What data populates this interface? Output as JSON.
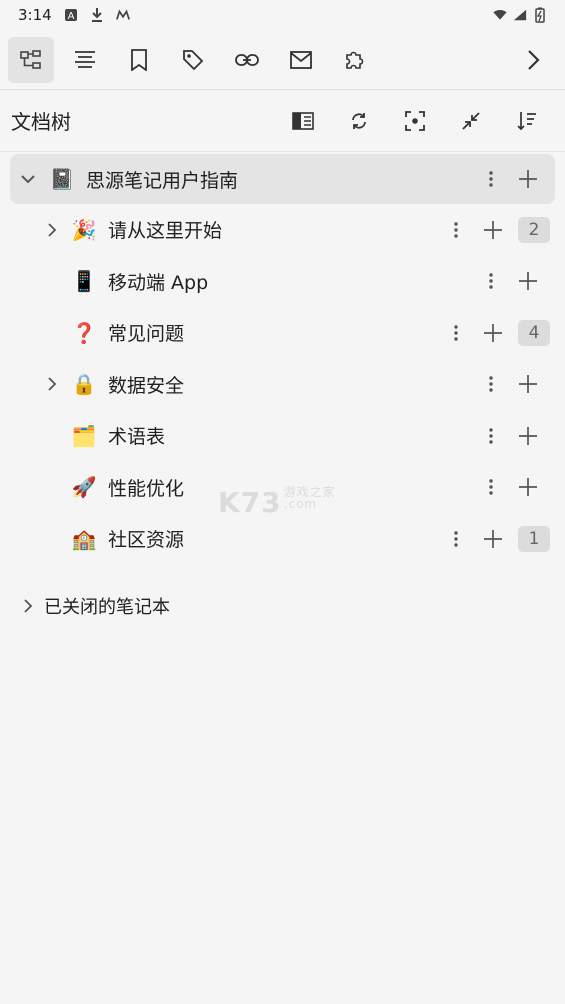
{
  "status_bar": {
    "time": "3:14"
  },
  "toolbar": {
    "tabs": [
      "file-tree",
      "outline",
      "bookmarks",
      "tags",
      "backlinks",
      "inbox",
      "plugins"
    ],
    "active_tab": "file-tree"
  },
  "panel": {
    "title": "文档树"
  },
  "notebook": {
    "icon": "📓",
    "label": "思源笔记用户指南"
  },
  "docs": [
    {
      "icon": "🎉",
      "label": "请从这里开始",
      "expandable": true,
      "count": "2"
    },
    {
      "icon": "📱",
      "label": "移动端 App",
      "expandable": false,
      "count": ""
    },
    {
      "icon": "❓",
      "label": "常见问题",
      "expandable": false,
      "count": "4"
    },
    {
      "icon": "🔒",
      "label": "数据安全",
      "expandable": true,
      "count": ""
    },
    {
      "icon": "🗂️",
      "label": "术语表",
      "expandable": false,
      "count": ""
    },
    {
      "icon": "🚀",
      "label": "性能优化",
      "expandable": false,
      "count": ""
    },
    {
      "icon": "🏫",
      "label": "社区资源",
      "expandable": false,
      "count": "1"
    }
  ],
  "closed_notebooks": {
    "label": "已关闭的笔记本"
  },
  "watermark": {
    "main": "K73",
    "sub1": "游戏之家",
    "sub2": ".com"
  }
}
